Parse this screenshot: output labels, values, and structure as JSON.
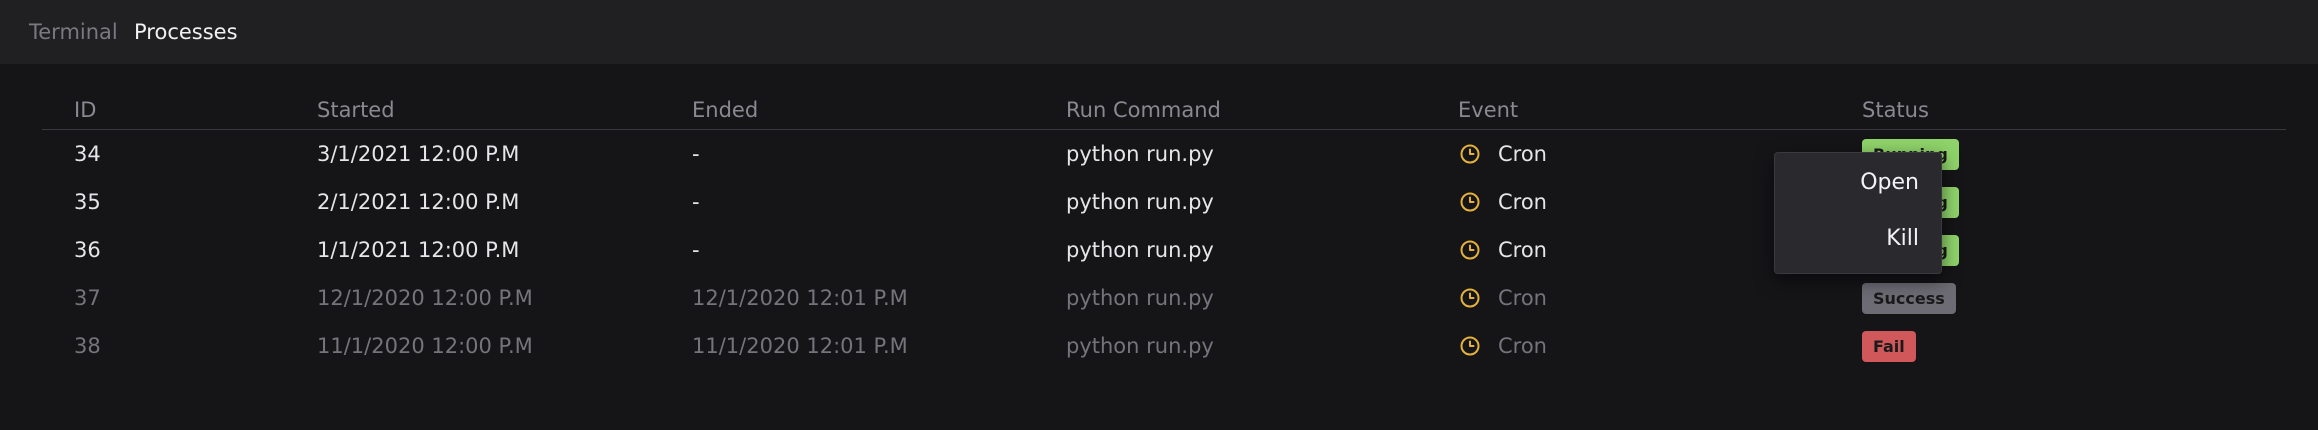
{
  "tabs": {
    "terminal": "Terminal",
    "processes": "Processes"
  },
  "columns": {
    "id": "ID",
    "started": "Started",
    "ended": "Ended",
    "run_command": "Run Command",
    "event": "Event",
    "status": "Status"
  },
  "rows": [
    {
      "id": "34",
      "started": "3/1/2021 12:00 P.M",
      "ended": "-",
      "run_command": "python run.py",
      "event": "Cron",
      "event_icon": "clock-icon",
      "status": "Running",
      "status_color": "#8fd36a",
      "state": "active"
    },
    {
      "id": "35",
      "started": "2/1/2021 12:00 P.M",
      "ended": "-",
      "run_command": "python run.py",
      "event": "Cron",
      "event_icon": "clock-icon",
      "status": "Running",
      "status_color": "#8fd36a",
      "state": "active"
    },
    {
      "id": "36",
      "started": "1/1/2021 12:00 P.M",
      "ended": "-",
      "run_command": "python run.py",
      "event": "Cron",
      "event_icon": "clock-icon",
      "status": "Running",
      "status_color": "#8fd36a",
      "state": "active"
    },
    {
      "id": "37",
      "started": "12/1/2020 12:00 P.M",
      "ended": "12/1/2020 12:01 P.M",
      "run_command": "python run.py",
      "event": "Cron",
      "event_icon": "clock-icon",
      "status": "Success",
      "status_color": "#6d6b73",
      "state": "dim"
    },
    {
      "id": "38",
      "started": "11/1/2020 12:00 P.M",
      "ended": "11/1/2020 12:01 P.M",
      "run_command": "python run.py",
      "event": "Cron",
      "event_icon": "clock-icon",
      "status": "Fail",
      "status_color": "#d0585a",
      "state": "dim"
    }
  ],
  "context_menu": {
    "open": "Open",
    "kill": "Kill"
  },
  "colors": {
    "clock_icon": "#e5b23c",
    "background": "#151417",
    "tabbar": "#201f22"
  }
}
